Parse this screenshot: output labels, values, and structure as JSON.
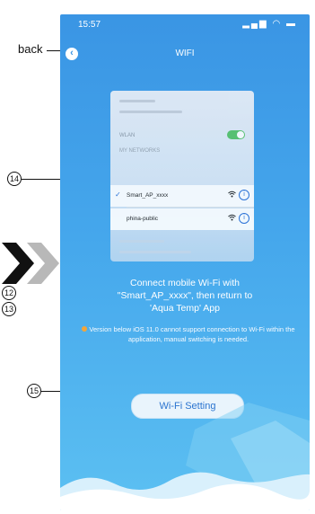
{
  "annotations": {
    "back": "back",
    "n14": "14",
    "n12": "12",
    "n13": "13",
    "n15": "15"
  },
  "status_bar": {
    "time": "15:57",
    "icons": "ᵴ ✉ ▬"
  },
  "header": {
    "back_icon": "‹",
    "title": "WIFI"
  },
  "preview": {
    "wlan_label": "WLAN",
    "section_label": "MY NETWORKS",
    "networks": [
      {
        "ssid": "Smart_AP_xxxx",
        "selected": true,
        "check": "✓",
        "signal": "wifi-icon",
        "info": "i"
      },
      {
        "ssid": "phina-public",
        "selected": false,
        "check": "",
        "signal": "wifi-icon",
        "info": "i"
      }
    ]
  },
  "message": {
    "line1": "Connect mobile Wi-Fi with",
    "line2": "\"Smart_AP_xxxx\", then return to",
    "line3": "'Aqua Temp' App"
  },
  "note": {
    "text": "Version below iOS 11.0 cannot support connection to Wi-Fi within the application, manual switching is needed."
  },
  "button": {
    "label": "Wi-Fi Setting"
  },
  "colors": {
    "accent": "#3a95e4",
    "button_text": "#2b74cf",
    "note_dot": "#f2a53b"
  }
}
